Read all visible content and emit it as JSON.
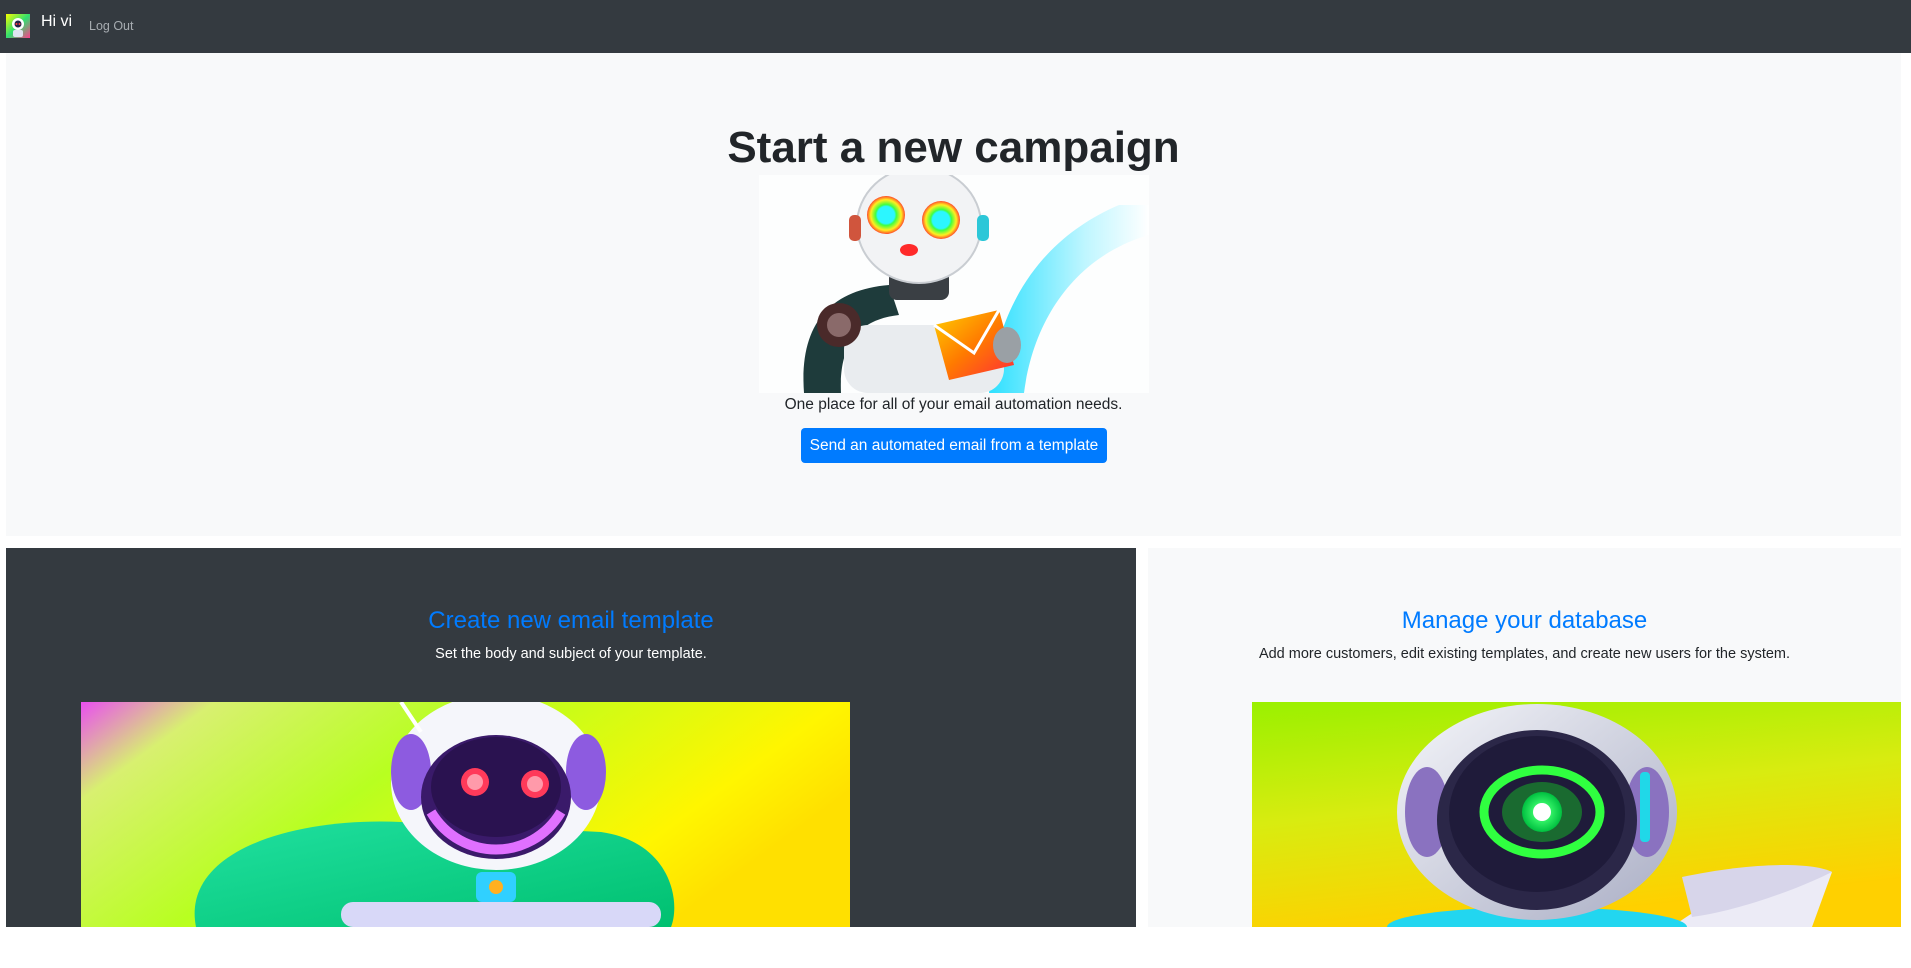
{
  "navbar": {
    "greeting": "Hi vi",
    "logout_label": "Log Out",
    "background": "#343a40"
  },
  "hero": {
    "title": "Start a new campaign",
    "tagline": "One place for all of your email automation needs.",
    "button_label": "Send an automated email from a template",
    "button_color": "#007bff"
  },
  "cards": {
    "template": {
      "title": "Create new email template",
      "description": "Set the body and subject of your template."
    },
    "database": {
      "title": "Manage your database",
      "description": "Add more customers, edit existing templates, and create new users for the system."
    }
  },
  "accent_color": "#007bff"
}
